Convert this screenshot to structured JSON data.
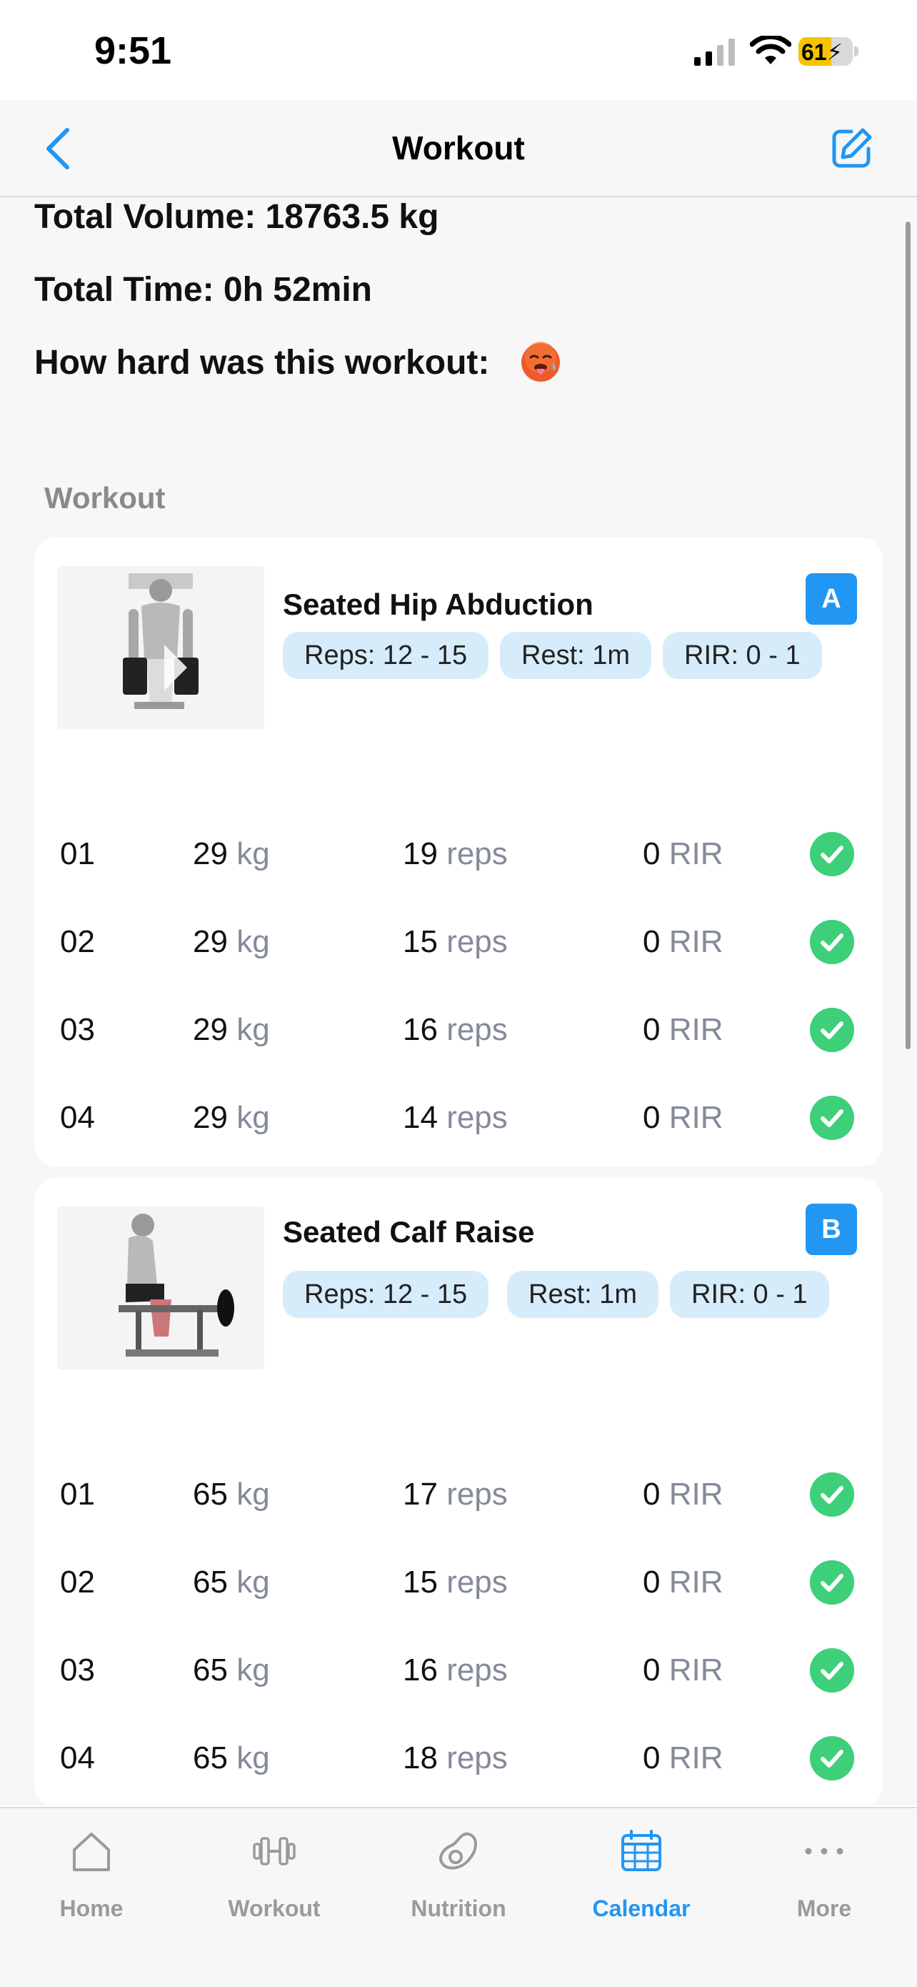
{
  "status_bar": {
    "time": "9:51",
    "battery_percent": "61",
    "battery_level": 0.61
  },
  "nav": {
    "title": "Workout",
    "back_icon": "chevron-left-icon",
    "edit_icon": "edit-icon"
  },
  "summary": {
    "total_volume": "Total Volume: 18763.5 kg",
    "total_time": "Total Time: 0h 52min",
    "difficulty_label": "How hard was this workout:",
    "difficulty_emoji": "hot-face-emoji"
  },
  "section_title": "Workout",
  "exercises": [
    {
      "name": "Seated Hip Abduction",
      "letter": "A",
      "reps_chip": "Reps: 12 - 15",
      "rest_chip": "Rest: 1m",
      "rir_chip": "RIR: 0 - 1",
      "sets": [
        {
          "num": "01",
          "weight": "29",
          "weight_unit": "kg",
          "reps": "19",
          "reps_unit": "reps",
          "rir": "0",
          "rir_unit": "RIR",
          "done": true
        },
        {
          "num": "02",
          "weight": "29",
          "weight_unit": "kg",
          "reps": "15",
          "reps_unit": "reps",
          "rir": "0",
          "rir_unit": "RIR",
          "done": true
        },
        {
          "num": "03",
          "weight": "29",
          "weight_unit": "kg",
          "reps": "16",
          "reps_unit": "reps",
          "rir": "0",
          "rir_unit": "RIR",
          "done": true
        },
        {
          "num": "04",
          "weight": "29",
          "weight_unit": "kg",
          "reps": "14",
          "reps_unit": "reps",
          "rir": "0",
          "rir_unit": "RIR",
          "done": true
        }
      ]
    },
    {
      "name": "Seated Calf Raise",
      "letter": "B",
      "reps_chip": "Reps: 12 - 15",
      "rest_chip": "Rest: 1m",
      "rir_chip": "RIR: 0 - 1",
      "sets": [
        {
          "num": "01",
          "weight": "65",
          "weight_unit": "kg",
          "reps": "17",
          "reps_unit": "reps",
          "rir": "0",
          "rir_unit": "RIR",
          "done": true
        },
        {
          "num": "02",
          "weight": "65",
          "weight_unit": "kg",
          "reps": "15",
          "reps_unit": "reps",
          "rir": "0",
          "rir_unit": "RIR",
          "done": true
        },
        {
          "num": "03",
          "weight": "65",
          "weight_unit": "kg",
          "reps": "16",
          "reps_unit": "reps",
          "rir": "0",
          "rir_unit": "RIR",
          "done": true
        },
        {
          "num": "04",
          "weight": "65",
          "weight_unit": "kg",
          "reps": "18",
          "reps_unit": "reps",
          "rir": "0",
          "rir_unit": "RIR",
          "done": true
        }
      ]
    }
  ],
  "tabs": [
    {
      "label": "Home",
      "icon": "home-icon",
      "active": false
    },
    {
      "label": "Workout",
      "icon": "dumbbell-icon",
      "active": false
    },
    {
      "label": "Nutrition",
      "icon": "avocado-icon",
      "active": false
    },
    {
      "label": "Calendar",
      "icon": "calendar-icon",
      "active": true
    },
    {
      "label": "More",
      "icon": "more-dots-icon",
      "active": false
    }
  ],
  "colors": {
    "accent": "#2196f3",
    "check_green": "#3ecf7a",
    "chip_bg": "#d6ecfb",
    "battery_yellow": "#f5c400"
  }
}
